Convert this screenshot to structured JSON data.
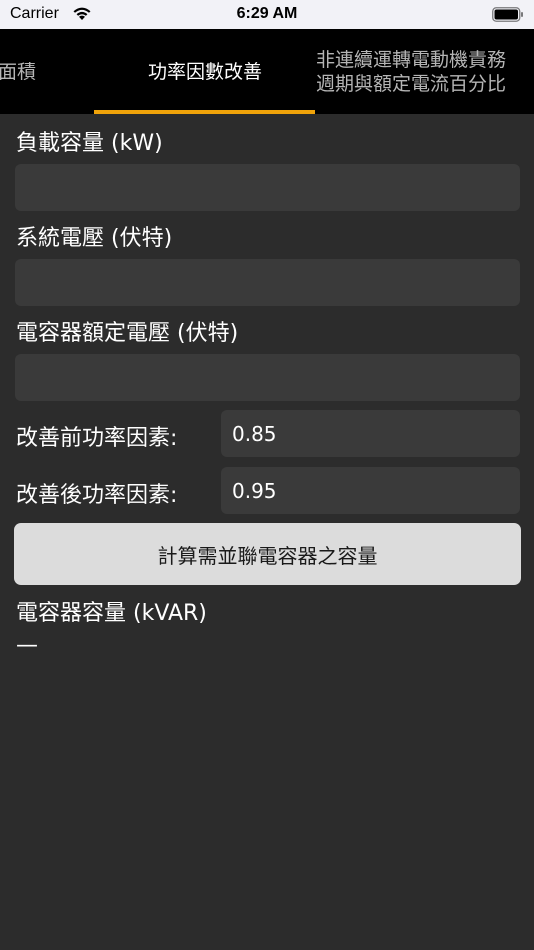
{
  "status_bar": {
    "carrier": "Carrier",
    "time": "6:29 AM"
  },
  "tabs": {
    "left": "面積",
    "active": "功率因數改善",
    "right_line1": "非連續運轉電動機責務",
    "right_line2": "週期與額定電流百分比"
  },
  "form": {
    "load_capacity_label": "負載容量 (kW)",
    "load_capacity_value": "",
    "system_voltage_label": "系統電壓 (伏特)",
    "system_voltage_value": "",
    "capacitor_voltage_label": "電容器額定電壓 (伏特)",
    "capacitor_voltage_value": "",
    "pf_before_label": "改善前功率因素:",
    "pf_before_value": "0.85",
    "pf_after_label": "改善後功率因素:",
    "pf_after_value": "0.95"
  },
  "calculate_button": "計算需並聯電容器之容量",
  "result": {
    "label": "電容器容量 (kVAR)",
    "value": "—"
  },
  "colors": {
    "background": "#2c2c2c",
    "tabbar": "#000000",
    "accent": "#f0a30a",
    "field": "#3a3a3a",
    "button": "#dcdcdc"
  }
}
